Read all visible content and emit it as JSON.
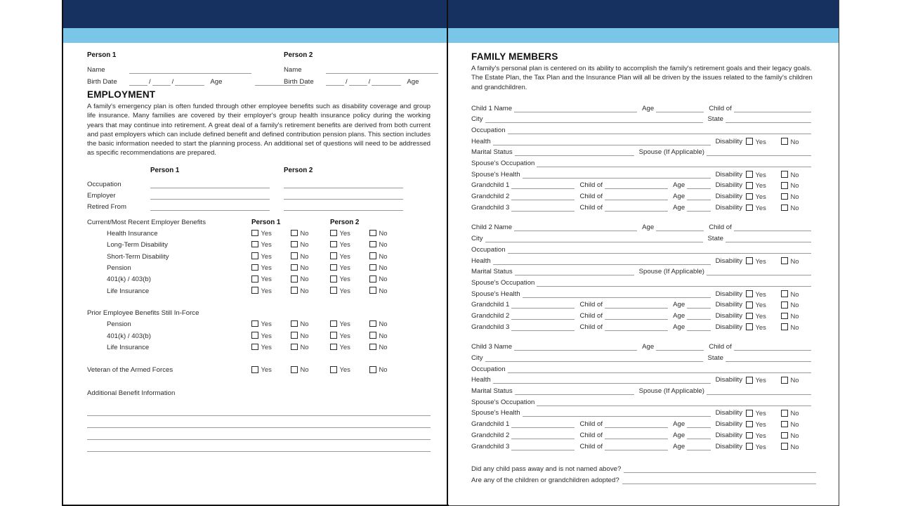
{
  "theme": {
    "navy": "#16315f",
    "cyan": "#79c6e8",
    "rule": "#9a9a9a",
    "text": "#2c2c2c"
  },
  "left_page": {
    "persons": [
      {
        "header": "Person 1",
        "name_label": "Name",
        "birth_label": "Birth Date",
        "age_label": "Age",
        "slash": "/"
      },
      {
        "header": "Person 2",
        "name_label": "Name",
        "birth_label": "Birth Date",
        "age_label": "Age",
        "slash": "/"
      }
    ],
    "employment": {
      "title": "EMPLOYMENT",
      "intro": "A family's emergency plan is often funded through other employee benefits such as disability coverage and group life insurance. Many families are covered by their employer's group health insurance policy during the working years that may continue into retirement. A great deal of a family's retirement benefits are derived from both current and past employers which can include defined benefit and defined contribution pension plans. This section includes the basic information needed to start the planning process. An additional set of questions will need to be addressed as specific recommendations are prepared.",
      "col_person1": "Person 1",
      "col_person2": "Person 2",
      "rows": [
        "Occupation",
        "Employer",
        "Retired From"
      ]
    },
    "current_benefits": {
      "heading": "Current/Most Recent Employer Benefits",
      "col_person1": "Person 1",
      "col_person2": "Person 2",
      "items": [
        "Health Insurance",
        "Long-Term Disability",
        "Short-Term Disability",
        "Pension",
        "401(k) / 403(b)",
        "Life Insurance"
      ]
    },
    "prior_benefits": {
      "heading": "Prior Employee Benefits Still In-Force",
      "items": [
        "Pension",
        "401(k) / 403(b)",
        "Life Insurance"
      ]
    },
    "veteran": {
      "label": "Veteran of the Armed Forces"
    },
    "additional": {
      "label": "Additional Benefit Information",
      "line_count": 4
    },
    "yes_label": "Yes",
    "no_label": "No"
  },
  "right_page": {
    "title": "FAMILY MEMBERS",
    "intro": "A family's personal plan is centered on its ability to accomplish the family's retirement goals and their legacy goals. The Estate Plan, the Tax Plan and the Insurance Plan will all be driven by the issues related to the family's children and grandchildren.",
    "yes_label": "Yes",
    "no_label": "No",
    "labels": {
      "age": "Age",
      "child_of": "Child of",
      "city": "City",
      "state": "State",
      "occupation": "Occupation",
      "health": "Health",
      "disability": "Disability",
      "marital_status": "Marital Status",
      "spouse_if_applicable": "Spouse (If Applicable)",
      "spouse_occupation": "Spouse's Occupation",
      "spouse_health": "Spouse's Health"
    },
    "children": [
      {
        "name_label": "Child 1 Name",
        "grandchildren": [
          "Grandchild 1",
          "Grandchild 2",
          "Grandchild 3"
        ]
      },
      {
        "name_label": "Child 2 Name",
        "grandchildren": [
          "Grandchild 1",
          "Grandchild 2",
          "Grandchild 3"
        ]
      },
      {
        "name_label": "Child 3 Name",
        "grandchildren": [
          "Grandchild 1",
          "Grandchild 2",
          "Grandchild 3"
        ]
      }
    ],
    "questions": [
      "Did any child pass away and is not named above?",
      "Are any of the children or grandchildren adopted?"
    ]
  }
}
